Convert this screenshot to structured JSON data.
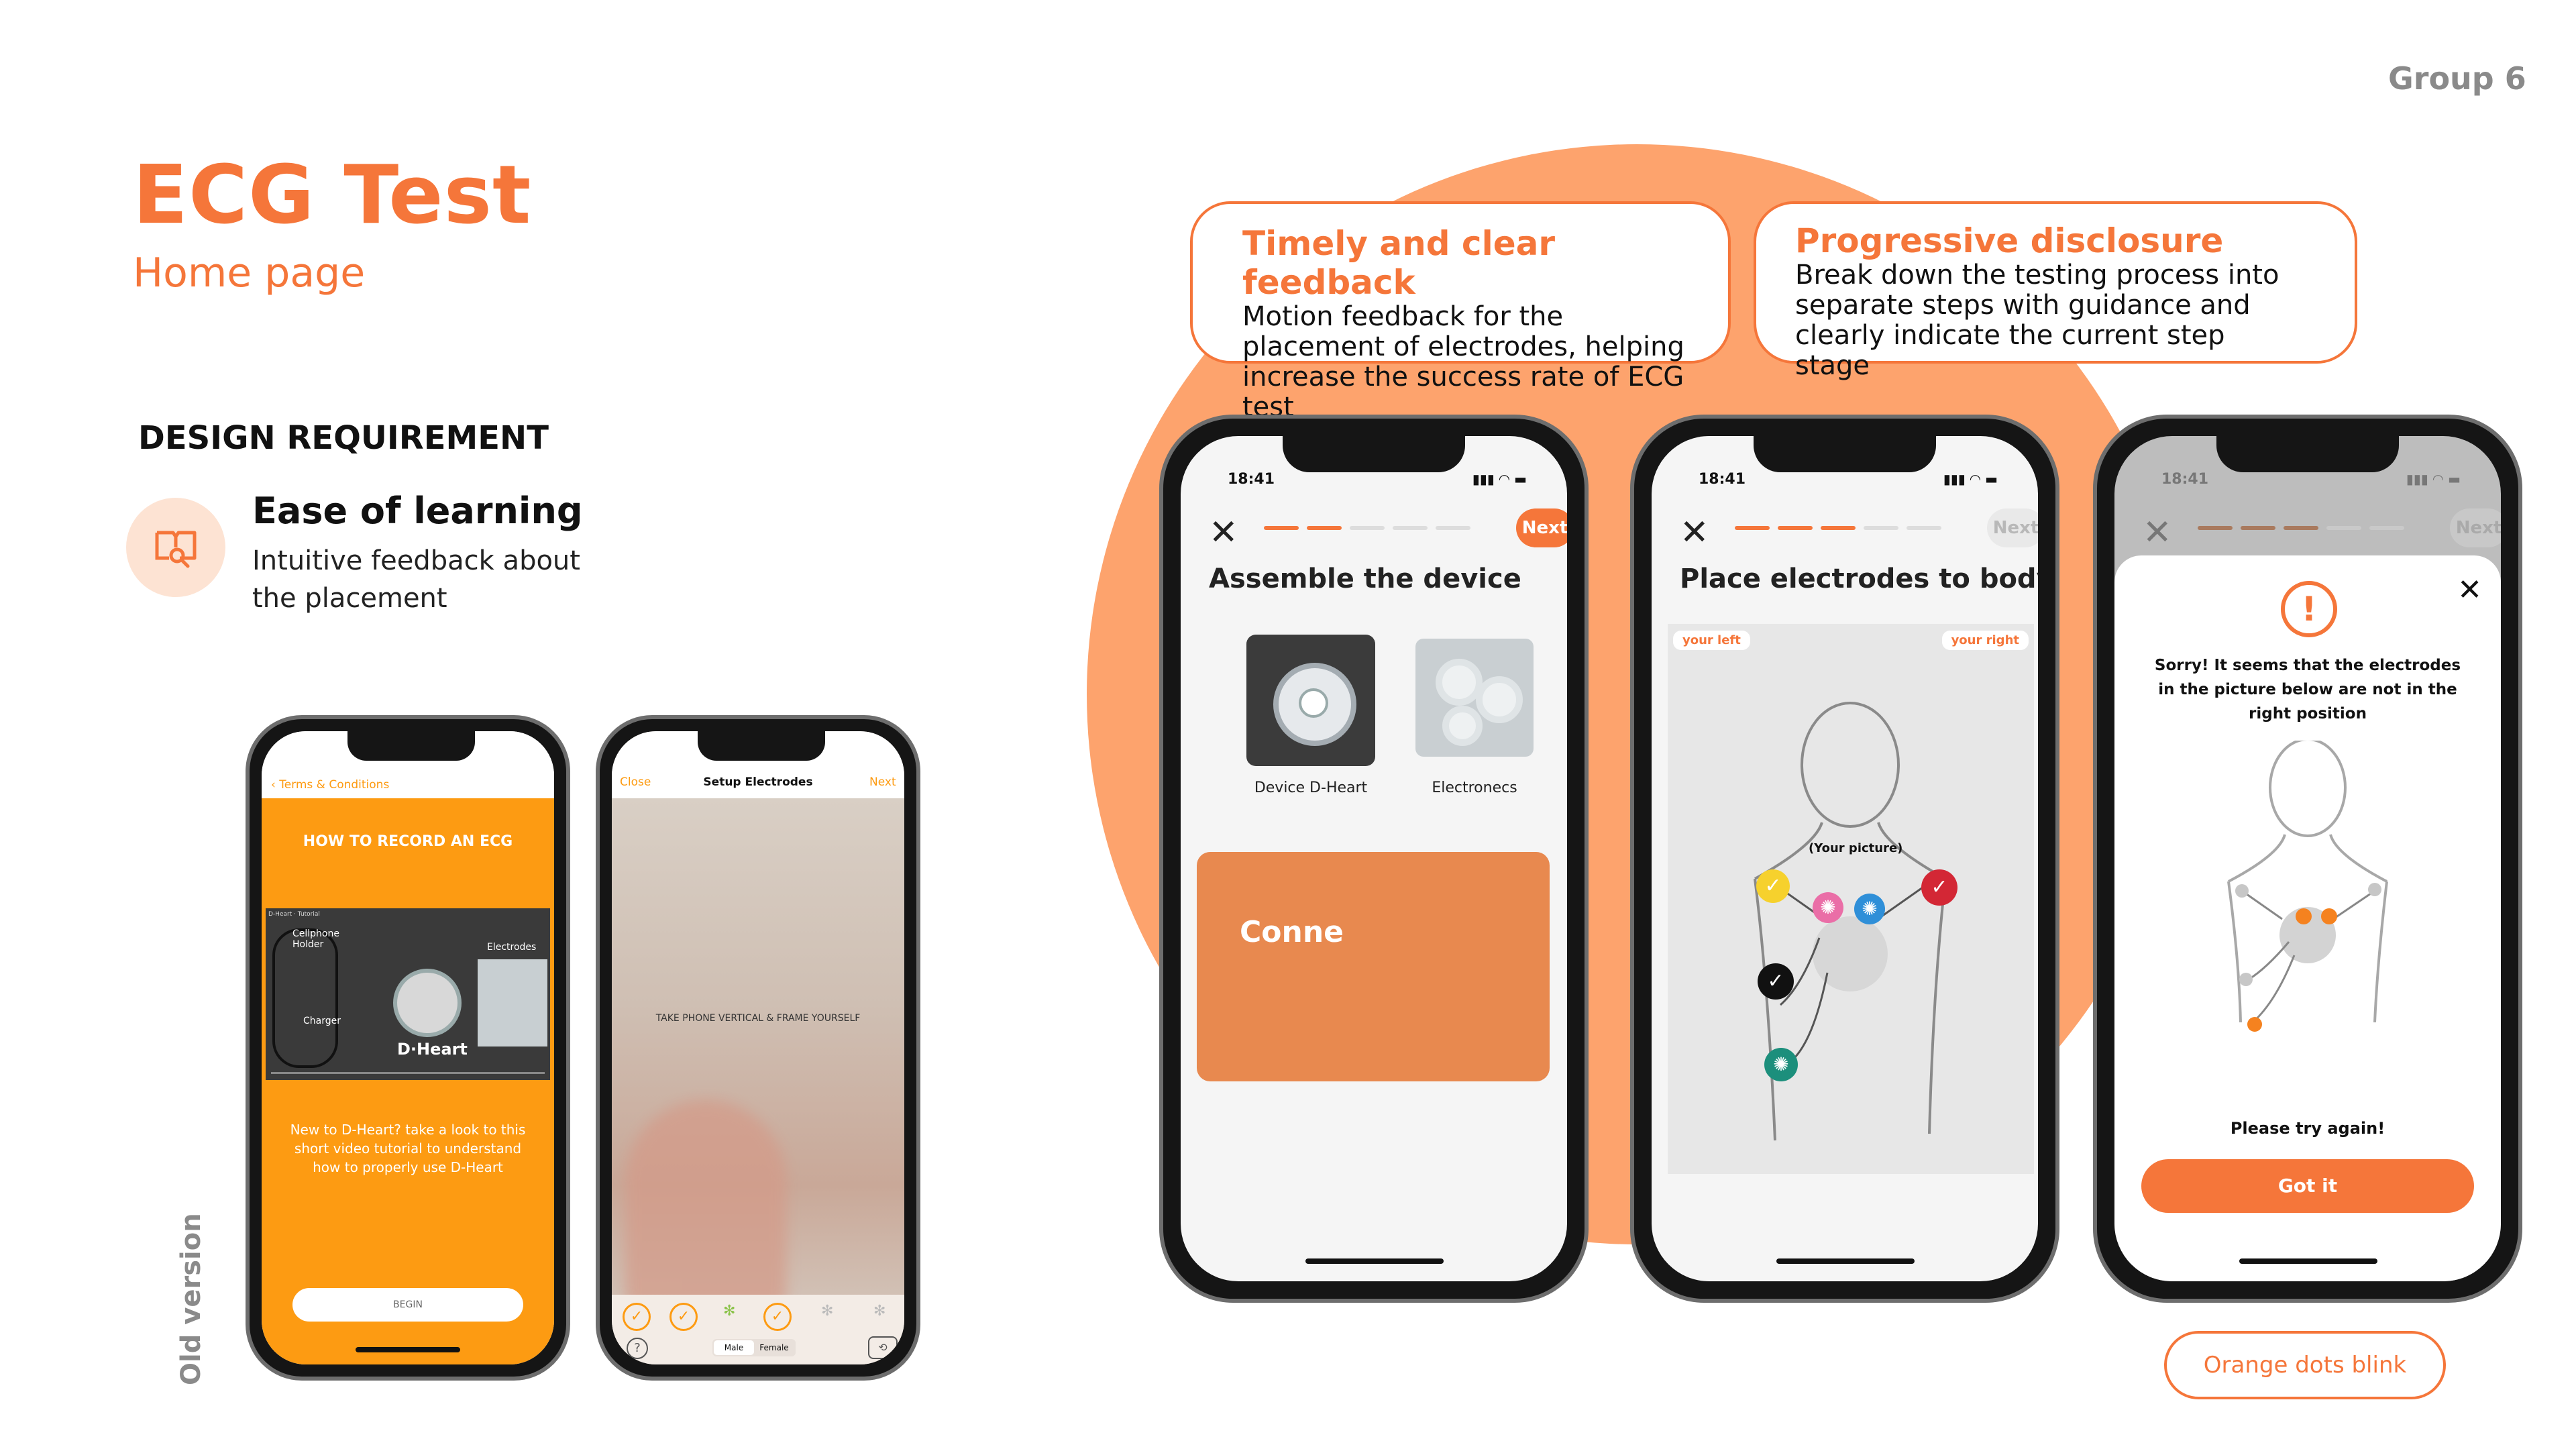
{
  "header": {
    "group": "Group 6",
    "title": "ECG Test",
    "subtitle": "Home page"
  },
  "requirement": {
    "heading": "DESIGN REQUIREMENT",
    "title": "Ease of learning",
    "description": "Intuitive feedback about the placement"
  },
  "old_version_label": "Old version",
  "callouts": [
    {
      "title": "Timely and clear feedback",
      "description": "Motion feedback for the placement of electrodes, helping increase the success rate of ECG test"
    },
    {
      "title": "Progressive disclosure",
      "description": "Break down the testing process into separate steps with guidance and clearly indicate the current step stage"
    }
  ],
  "blink_label": "Orange dots blink",
  "old_phone_1": {
    "back": "Terms & Conditions",
    "heading": "HOW TO RECORD AN ECG",
    "video_labels": {
      "holder": "Cellphone Holder",
      "charger": "Charger",
      "electrodes": "Electrodes",
      "brand": "D·Heart",
      "top": "D-Heart · Tutorial"
    },
    "body": "New to D-Heart? take a look to this short video tutorial to understand how to properly use D-Heart",
    "button": "BEGIN"
  },
  "old_phone_2": {
    "close": "Close",
    "title": "Setup Electrodes",
    "next": "Next",
    "instruction": "TAKE PHONE VERTICAL & FRAME YOURSELF",
    "tab_male": "Male",
    "tab_female": "Female"
  },
  "phone_1": {
    "time": "18:41",
    "next": "Next",
    "title": "Assemble the device",
    "item1": "Device D-Heart",
    "item2": "Electronecs",
    "card_text": "Conne"
  },
  "phone_2": {
    "time": "18:41",
    "next": "Next",
    "title": "Place electrodes to body",
    "left": "your left",
    "right": "your right",
    "picture": "(Your picture)"
  },
  "phone_3": {
    "time": "18:41",
    "next": "Next",
    "message": "Sorry! It seems that the electrodes in the picture below are not in the right position",
    "retry": "Please try again!",
    "button": "Got it"
  },
  "colors": {
    "accent": "#f5763a",
    "circle": "#fda36d",
    "old_orange": "#fd9b12"
  }
}
